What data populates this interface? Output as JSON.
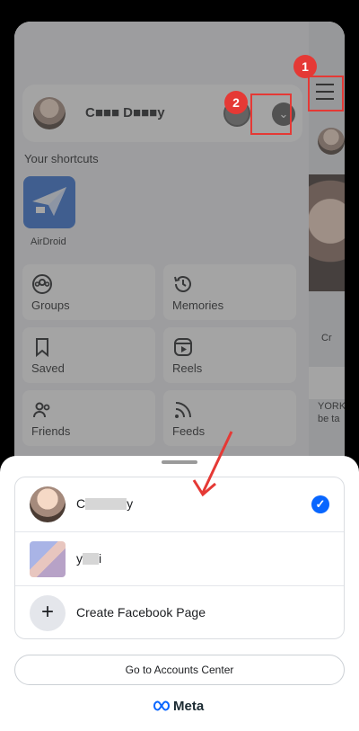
{
  "profile": {
    "name": "C■■■ D■■■y"
  },
  "shortcuts": {
    "title": "Your shortcuts",
    "items": [
      {
        "label": "AirDroid"
      }
    ]
  },
  "menu_tiles": [
    {
      "label": "Groups"
    },
    {
      "label": "Memories"
    },
    {
      "label": "Saved"
    },
    {
      "label": "Reels"
    },
    {
      "label": "Friends"
    },
    {
      "label": "Feeds"
    }
  ],
  "annotations": {
    "badge_1": "1",
    "badge_2": "2"
  },
  "side_preview": {
    "text_1": "Cr",
    "text_2": "YORK",
    "text_3": "be ta"
  },
  "sheet": {
    "accounts": [
      {
        "name_prefix": "C",
        "name_suffix": "y",
        "selected": true
      },
      {
        "name_prefix": "y",
        "name_suffix": "i",
        "selected": false
      }
    ],
    "create_page_label": "Create Facebook Page",
    "accounts_center_label": "Go to Accounts Center",
    "brand": "Meta"
  },
  "colors": {
    "accent": "#0866ff",
    "annotation": "#e53935"
  }
}
